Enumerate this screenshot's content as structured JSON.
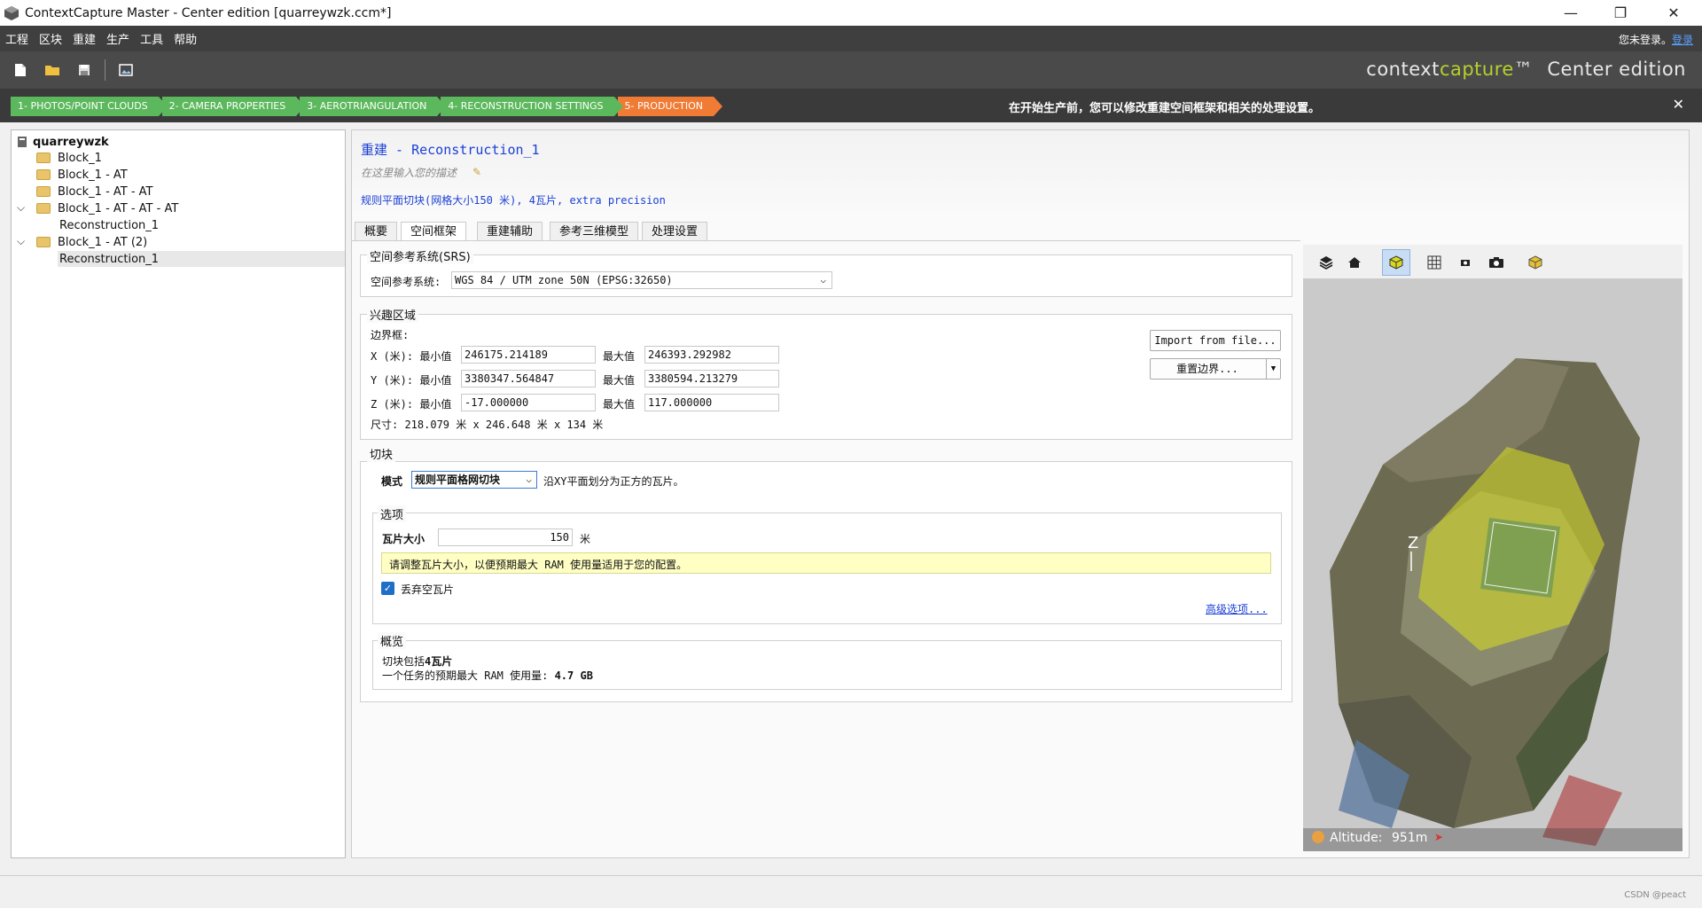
{
  "window": {
    "title": "ContextCapture Master - Center edition [quarreywzk.ccm*]",
    "minimize": "—",
    "restore": "❐",
    "close": "✕"
  },
  "menu": {
    "items": [
      "工程",
      "区块",
      "重建",
      "生产",
      "工具",
      "帮助"
    ],
    "login_prefix": "您未登录。",
    "login_link": "登录"
  },
  "brand": {
    "context": "context",
    "capture": "capture",
    "tm": "™",
    "edition": "Center edition"
  },
  "steps": [
    "1- PHOTOS/POINT CLOUDS",
    "2- CAMERA PROPERTIES",
    "3- AEROTRIANGULATION",
    "4- RECONSTRUCTION SETTINGS",
    "5- PRODUCTION"
  ],
  "steps_message": "在开始生产前，您可以修改重建空间框架和相关的处理设置。",
  "tree": {
    "root": "quarreywzk",
    "items": [
      "Block_1",
      "Block_1 - AT",
      "Block_1 - AT - AT",
      "Block_1 - AT - AT - AT",
      "Reconstruction_1",
      "Block_1 - AT (2)",
      "Reconstruction_1"
    ]
  },
  "header": {
    "title": "重建 - Reconstruction_1",
    "description_placeholder": "在这里输入您的描述",
    "summary": "规则平面切块(网格大小150 米), 4瓦片, extra precision"
  },
  "tabs": [
    "概要",
    "空间框架",
    "重建辅助",
    "参考三维模型",
    "处理设置"
  ],
  "srs": {
    "group": "空间参考系统(SRS)",
    "label": "空间参考系统:",
    "value": "WGS 84 / UTM zone 50N (EPSG:32650)"
  },
  "roi": {
    "group": "兴趣区域",
    "bbox_label": "边界框:",
    "x_label": "X (米): 最小值",
    "y_label": "Y (米): 最小值",
    "z_label": "Z (米): 最小值",
    "max_label": "最大值",
    "x_min": "246175.214189",
    "x_max": "246393.292982",
    "y_min": "3380347.564847",
    "y_max": "3380594.213279",
    "z_min": "-17.000000",
    "z_max": "117.000000",
    "size": "尺寸: 218.079 米 x 246.648 米 x 134 米",
    "import_button": "Import from file...",
    "reset_button": "重置边界..."
  },
  "tiling": {
    "group": "切块",
    "mode_label": "模式",
    "mode_value": "规则平面格网切块",
    "mode_desc": "沿XY平面划分为正方的瓦片。",
    "options_group": "选项",
    "tile_size_label": "瓦片大小",
    "tile_size_value": "150",
    "tile_unit": "米",
    "hint": "请调整瓦片大小，以便预期最大 RAM 使用量适用于您的配置。",
    "discard_label": "丢弃空瓦片",
    "discard_checked": true,
    "advanced": "高级选项..."
  },
  "overview": {
    "group": "概览",
    "line1_prefix": "切块包括",
    "line1_value": "4瓦片",
    "line2_prefix": "一个任务的预期最大 RAM 使用量: ",
    "line2_value": "4.7 GB"
  },
  "viewer": {
    "altitude_label": "Altitude:",
    "altitude_value": "951m",
    "axis_label": "Z"
  },
  "statusbar": {
    "watermark": "CSDN @peact"
  },
  "colors": {
    "accent_green": "#5cb85c",
    "accent_orange": "#f07b35",
    "brand_yellow": "#b7cf2c",
    "link_blue": "#1a3fd6"
  }
}
